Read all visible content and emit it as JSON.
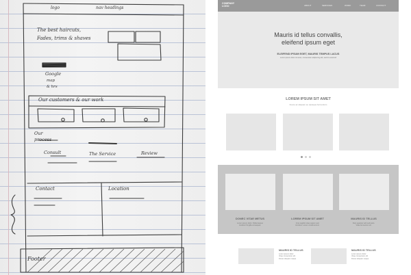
{
  "sketch": {
    "nav_items": [
      "logo",
      "nav headings"
    ],
    "hero_text": [
      "The best haircuts,",
      "Fades, trims & shaves"
    ],
    "cta": [
      "Google",
      "map",
      "& hrs"
    ],
    "customers_title": "Our customers & our work",
    "process_title": [
      "Our",
      "process"
    ],
    "process_steps": [
      "Consult",
      "The Service",
      "Review"
    ],
    "contact_label": "Contact",
    "location_label": "Location",
    "footer_label": "Footer"
  },
  "wireframe": {
    "logo": [
      "COMPANY",
      "LOGO"
    ],
    "nav": [
      "ABOUT",
      "SERVICES",
      "WORK",
      "TEAM",
      "CONTACT"
    ],
    "hero": {
      "title": [
        "Mauris id tellus convallis,",
        "eleifend ipsum eget"
      ],
      "subtitle": "ELEIFEND IPSUM EGET, MAURIS TEMPUS LACUS",
      "small": "Lorem ipsum dolor sit amet, consectetur adipiscing elit, sed do eiusmod"
    },
    "section1": {
      "title": "LOREM IPSUM SIT AMET",
      "subtitle": "Fusce ac aliquam at, Quisque fermentum"
    },
    "carousel": {
      "count": 3,
      "active": 0
    },
    "band_cards": [
      {
        "title": "DONEC VITAE METUS",
        "text": [
          "Lorem ipsum dolor. Pellentesque",
          "tincidunt fringilla consequat."
        ]
      },
      {
        "title": "LOREM IPSUM SIT AMET",
        "text": [
          "Cras sagittis vitae sapien sed,",
          "tincidunt. Lorem condimentum."
        ]
      },
      {
        "title": "MAURIS ID TELLUS",
        "text": [
          "Duis egestas velit sed justo.",
          "Vitae fermentum sit."
        ]
      }
    ],
    "bottom_items": [
      {
        "title": "MAURIS ID TELLUS",
        "text": [
          "Lorem ipsum dolor",
          "Vitae consectetur elit",
          "Donec aliquam neque"
        ]
      },
      {
        "title": "MAURIS ID TELLUS",
        "text": [
          "Lorem ipsum dolor",
          "Vitae consectetur elit",
          "Donec aliquam neque"
        ]
      }
    ]
  }
}
